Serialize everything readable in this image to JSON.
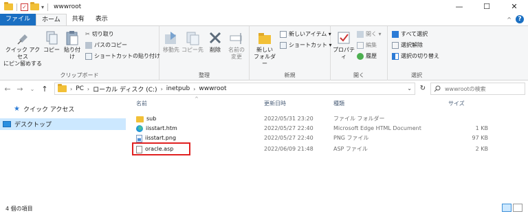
{
  "window": {
    "title": "wwwroot",
    "minimize": "—",
    "maximize": "☐",
    "close": "✕"
  },
  "ribbon_tabs": [
    "ファイル",
    "ホーム",
    "共有",
    "表示"
  ],
  "ribbon": {
    "clipboard": {
      "pin_label_1": "クイック アクセス",
      "pin_label_2": "にピン留めする",
      "copy_label": "コピー",
      "paste_label": "貼り付け",
      "cut_label": "切り取り",
      "copy_path_label": "パスのコピー",
      "paste_shortcut_label": "ショートカットの貼り付け",
      "group_label": "クリップボード"
    },
    "organize": {
      "move_label": "移動先",
      "copyto_label": "コピー先",
      "delete_label": "削除",
      "rename_label_1": "名前の",
      "rename_label_2": "変更",
      "group_label": "整理"
    },
    "new": {
      "new_folder_label_1": "新しい",
      "new_folder_label_2": "フォルダー",
      "new_item_label": "新しいアイテム ▾",
      "shortcut_label": "ショートカット ▾",
      "group_label": "新規"
    },
    "open": {
      "properties_label": "プロパティ",
      "open_label": "開く ▾",
      "edit_label": "編集",
      "history_label": "履歴",
      "group_label": "開く"
    },
    "select": {
      "select_all_label": "すべて選択",
      "select_none_label": "選択解除",
      "invert_label": "選択の切り替え",
      "group_label": "選択"
    }
  },
  "address": {
    "crumbs": [
      "PC",
      "ローカル ディスク (C:)",
      "inetpub",
      "wwwroot"
    ],
    "search_placeholder": "wwwrootの検索"
  },
  "nav_pane": {
    "quick_access": "クイック アクセス",
    "desktop": "デスクトップ"
  },
  "columns": {
    "name": "名前",
    "date": "更新日時",
    "type": "種類",
    "size": "サイズ"
  },
  "files": [
    {
      "name": "sub",
      "date": "2022/05/31 23:20",
      "type": "ファイル フォルダー",
      "size": "",
      "icon": "folder-icon"
    },
    {
      "name": "iisstart.htm",
      "date": "2022/05/27 22:40",
      "type": "Microsoft Edge HTML Document",
      "size": "1 KB",
      "icon": "edge-icon"
    },
    {
      "name": "iisstart.png",
      "date": "2022/05/27 22:40",
      "type": "PNG ファイル",
      "size": "97 KB",
      "icon": "png-icon"
    },
    {
      "name": "oracle.asp",
      "date": "2022/06/09 21:48",
      "type": "ASP ファイル",
      "size": "2 KB",
      "icon": "document-icon"
    }
  ],
  "status": {
    "item_count": "4 個の項目"
  },
  "colors": {
    "file_tab": "#1a6fc2",
    "highlight_border": "#e02020",
    "selection": "#cce8ff"
  }
}
